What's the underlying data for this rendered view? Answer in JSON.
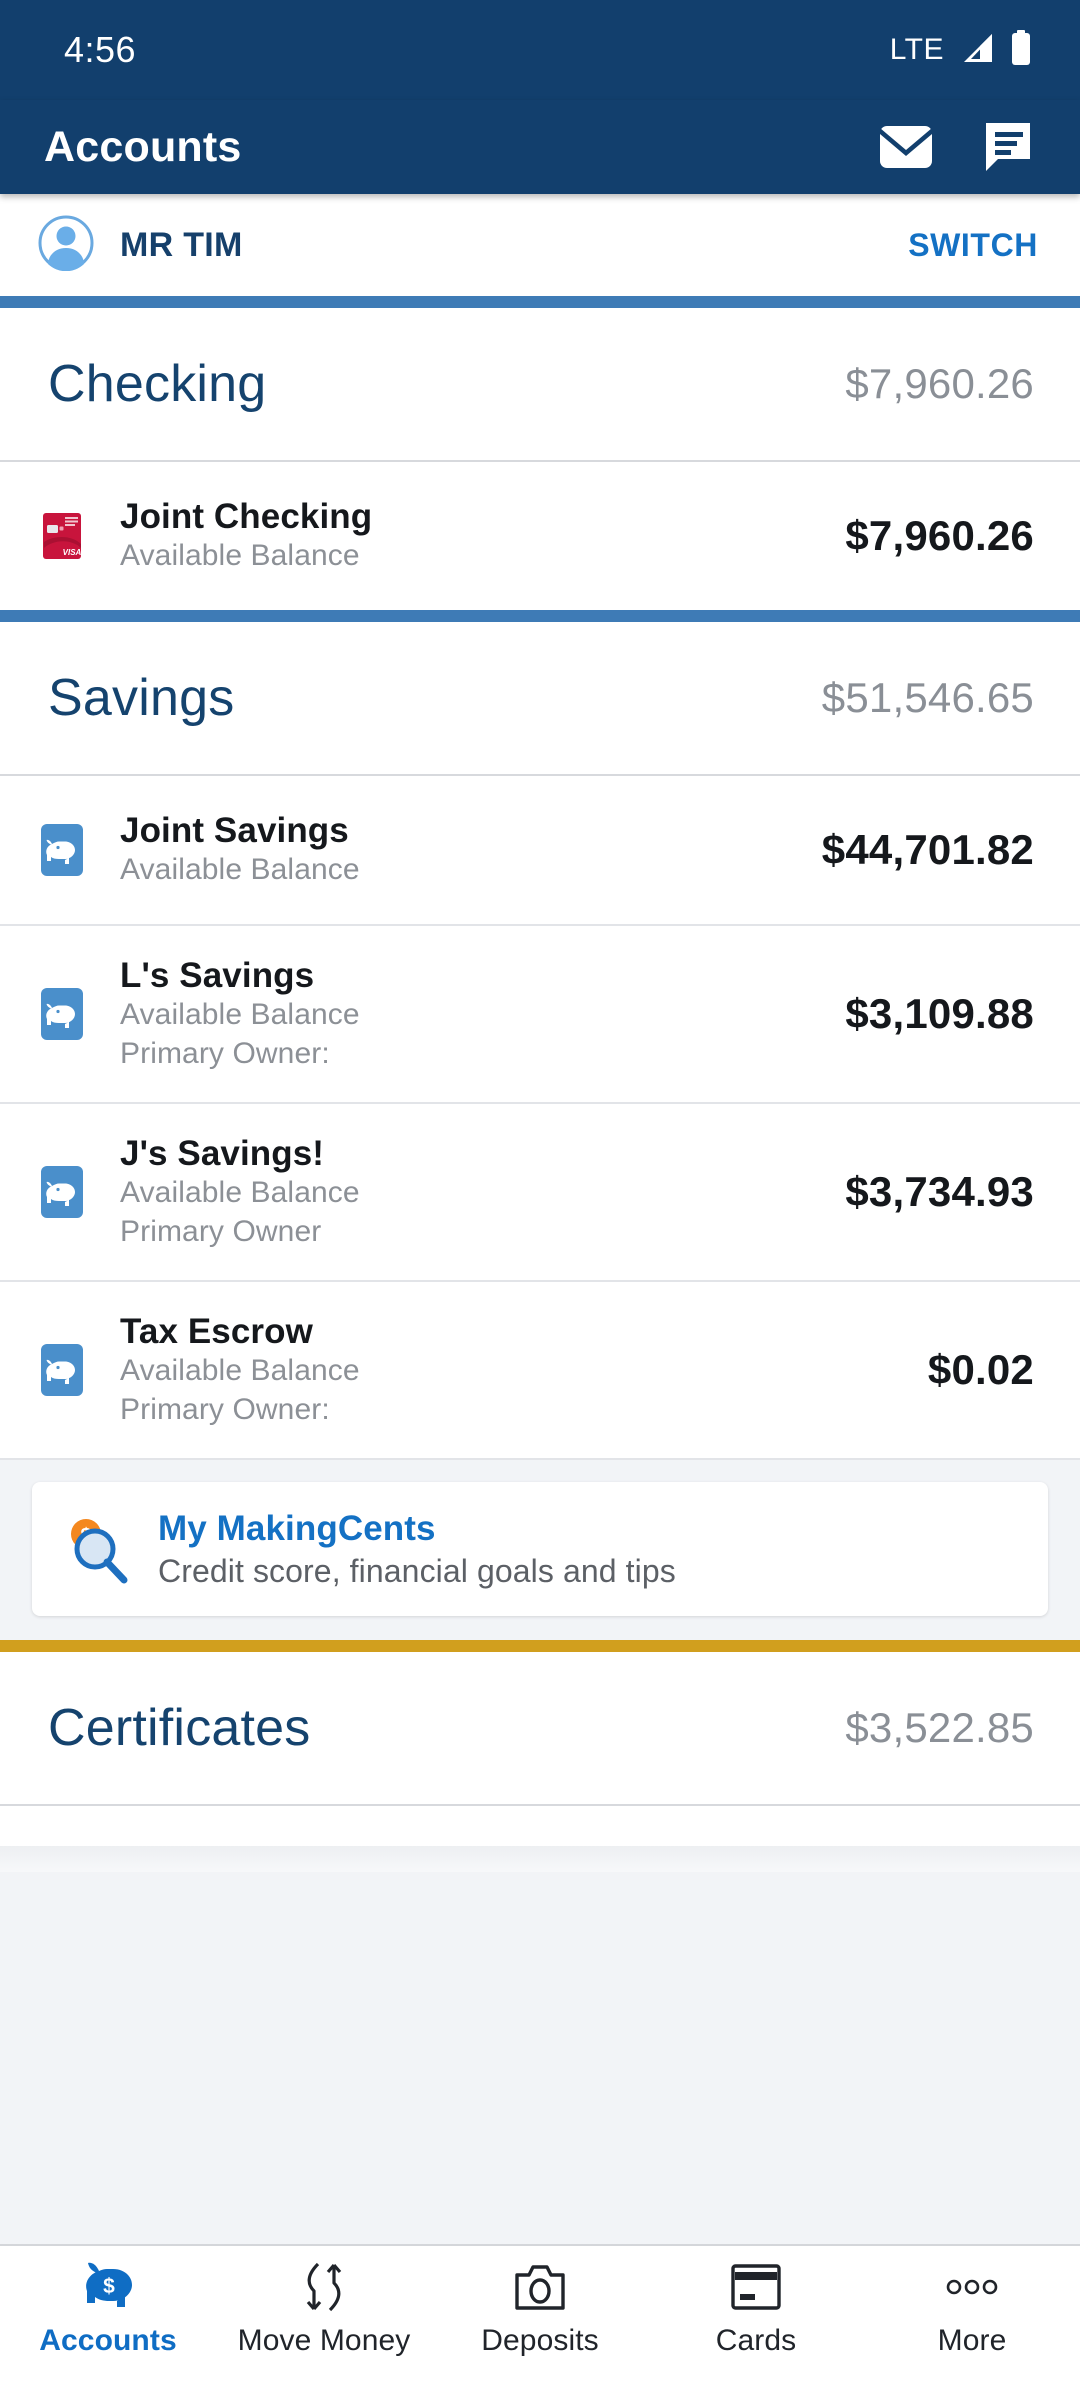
{
  "status_bar": {
    "time": "4:56",
    "network": "LTE",
    "signal_icon": "signal-bars-icon",
    "battery_icon": "battery-full-icon"
  },
  "app_bar": {
    "title": "Accounts",
    "mail_icon": "envelope-icon",
    "messages_icon": "chat-bubble-icon"
  },
  "user_row": {
    "avatar_icon": "user-avatar-icon",
    "name": "MR TIM",
    "switch_label": "SWITCH"
  },
  "sections": [
    {
      "title": "Checking",
      "total": "$7,960.26",
      "accounts": [
        {
          "icon": "visa-debit-card-icon",
          "name": "Joint Checking",
          "sub1": "Available Balance",
          "sub2": "",
          "amount": "$7,960.26"
        }
      ]
    },
    {
      "title": "Savings",
      "total": "$51,546.65",
      "accounts": [
        {
          "icon": "piggy-bank-icon",
          "name": "Joint Savings",
          "sub1": "Available Balance",
          "sub2": "",
          "amount": "$44,701.82"
        },
        {
          "icon": "piggy-bank-icon",
          "name": "L's Savings",
          "sub1": "Available Balance",
          "sub2": "Primary Owner:",
          "amount": "$3,109.88"
        },
        {
          "icon": "piggy-bank-icon",
          "name": "J's Savings!",
          "sub1": "Available Balance",
          "sub2": "Primary Owner",
          "amount": "$3,734.93"
        },
        {
          "icon": "piggy-bank-icon",
          "name": "Tax Escrow",
          "sub1": "Available Balance",
          "sub2": "Primary Owner:",
          "amount": "$0.02"
        }
      ]
    },
    {
      "title": "Certificates",
      "total": "$3,522.85",
      "accounts": []
    }
  ],
  "promo": {
    "icon": "magnifier-coin-icon",
    "title": "My MakingCents",
    "subtitle": "Credit score, financial goals and tips"
  },
  "bottom_nav": [
    {
      "icon": "piggy-bank-dollar-icon",
      "label": "Accounts",
      "active": true
    },
    {
      "icon": "transfer-arrows-icon",
      "label": "Move Money",
      "active": false
    },
    {
      "icon": "camera-icon",
      "label": "Deposits",
      "active": false
    },
    {
      "icon": "credit-card-icon",
      "label": "Cards",
      "active": false
    },
    {
      "icon": "more-dots-icon",
      "label": "More",
      "active": false
    }
  ],
  "colors": {
    "header_blue": "#123F6D",
    "section_title_blue": "#15436E",
    "divider_blue": "#3E7BB6",
    "divider_gold": "#D19F1E",
    "link_blue": "#1471C4",
    "card_red": "#C8143C",
    "piggy_blue": "#4A8FCB",
    "promo_orange": "#F4881F",
    "nav_active_blue": "#0F6DC4"
  }
}
